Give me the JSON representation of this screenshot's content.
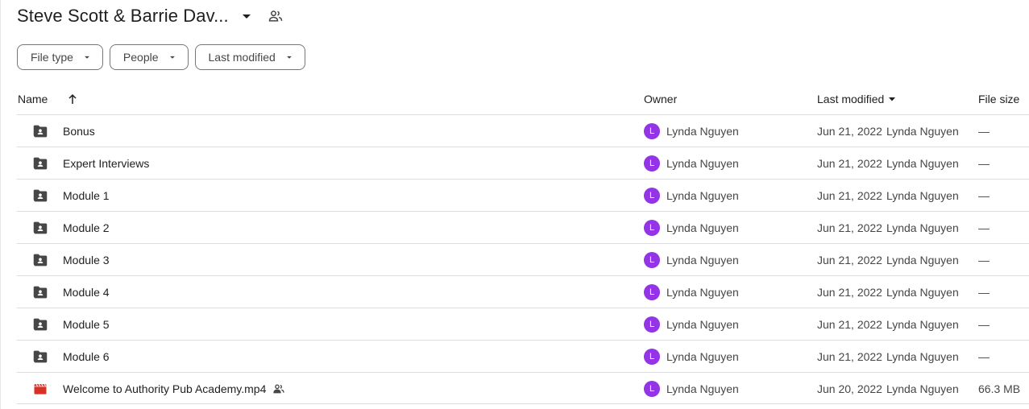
{
  "header": {
    "title": "Steve Scott & Barrie Dav...",
    "caret_icon": "arrow-drop-down-icon",
    "shared_icon": "people-icon"
  },
  "filters": [
    {
      "label": "File type"
    },
    {
      "label": "People"
    },
    {
      "label": "Last modified"
    }
  ],
  "columns": {
    "name": "Name",
    "owner": "Owner",
    "last_modified": "Last modified",
    "file_size": "File size",
    "sort_icon": "arrow-upward-icon",
    "sort_dir_icon": "arrow-drop-down-icon"
  },
  "colors": {
    "avatar": "#9334e6",
    "folder_icon": "#444746",
    "video_icon": "#d93025"
  },
  "rows": [
    {
      "name": "Bonus",
      "type": "folder",
      "owner_initial": "L",
      "owner": "Lynda Nguyen",
      "date": "Jun 21, 2022",
      "modified_by": "Lynda Nguyen",
      "size": "—"
    },
    {
      "name": "Expert Interviews",
      "type": "folder",
      "owner_initial": "L",
      "owner": "Lynda Nguyen",
      "date": "Jun 21, 2022",
      "modified_by": "Lynda Nguyen",
      "size": "—"
    },
    {
      "name": "Module 1",
      "type": "folder",
      "owner_initial": "L",
      "owner": "Lynda Nguyen",
      "date": "Jun 21, 2022",
      "modified_by": "Lynda Nguyen",
      "size": "—"
    },
    {
      "name": "Module 2",
      "type": "folder",
      "owner_initial": "L",
      "owner": "Lynda Nguyen",
      "date": "Jun 21, 2022",
      "modified_by": "Lynda Nguyen",
      "size": "—"
    },
    {
      "name": "Module 3",
      "type": "folder",
      "owner_initial": "L",
      "owner": "Lynda Nguyen",
      "date": "Jun 21, 2022",
      "modified_by": "Lynda Nguyen",
      "size": "—"
    },
    {
      "name": "Module 4",
      "type": "folder",
      "owner_initial": "L",
      "owner": "Lynda Nguyen",
      "date": "Jun 21, 2022",
      "modified_by": "Lynda Nguyen",
      "size": "—"
    },
    {
      "name": "Module 5",
      "type": "folder",
      "owner_initial": "L",
      "owner": "Lynda Nguyen",
      "date": "Jun 21, 2022",
      "modified_by": "Lynda Nguyen",
      "size": "—"
    },
    {
      "name": "Module 6",
      "type": "folder",
      "owner_initial": "L",
      "owner": "Lynda Nguyen",
      "date": "Jun 21, 2022",
      "modified_by": "Lynda Nguyen",
      "size": "—"
    },
    {
      "name": "Welcome to Authority Pub Academy.mp4",
      "type": "video",
      "shared": true,
      "owner_initial": "L",
      "owner": "Lynda Nguyen",
      "date": "Jun 20, 2022",
      "modified_by": "Lynda Nguyen",
      "size": "66.3 MB"
    }
  ]
}
